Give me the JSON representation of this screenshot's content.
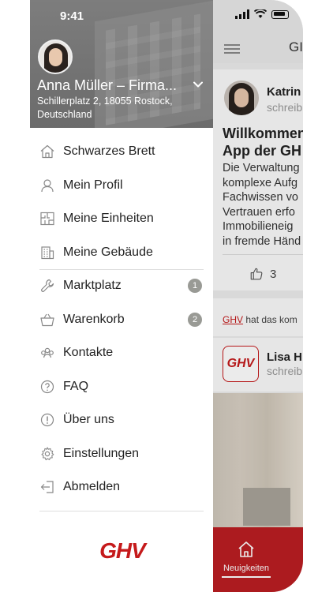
{
  "status_bar": {
    "time": "9:41"
  },
  "drawer": {
    "user_name": "Anna Müller – Firma...",
    "address": "Schillerplatz 2, 18055 Rostock, Deutschland",
    "menu_items": [
      {
        "label": "Schwarzes Brett",
        "icon": "house-icon"
      },
      {
        "label": "Mein Profil",
        "icon": "person-icon"
      },
      {
        "label": "Meine Einheiten",
        "icon": "floorplan-icon"
      },
      {
        "label": "Meine Gebäude",
        "icon": "building-icon"
      },
      {
        "label": "Marktplatz",
        "icon": "wrench-icon",
        "badge": "1"
      },
      {
        "label": "Warenkorb",
        "icon": "basket-icon",
        "badge": "2"
      },
      {
        "label": "Kontakte",
        "icon": "contacts-icon"
      },
      {
        "label": "FAQ",
        "icon": "question-icon"
      },
      {
        "label": "Über uns",
        "icon": "info-icon"
      },
      {
        "label": "Einstellungen",
        "icon": "gear-icon"
      },
      {
        "label": "Abmelden",
        "icon": "logout-icon"
      }
    ],
    "logo_text": "GHV"
  },
  "background": {
    "header_title": "GI",
    "post": {
      "author": "Katrin",
      "author_sub": "schreib",
      "title_lines": [
        "Willkommen",
        "App der GH"
      ],
      "body_lines": [
        "Die Verwaltung",
        "komplexe Aufg",
        "Fachwissen vo",
        "Vertrauen erfo",
        "Immobilieneig",
        "in fremde Händ"
      ],
      "likes": "3"
    },
    "notice": {
      "link": "GHV",
      "text": " hat das kom"
    },
    "post2": {
      "badge": "GHV",
      "author": "Lisa H",
      "author_sub": "schreib"
    },
    "tab": {
      "label": "Neuigkeiten"
    }
  },
  "colors": {
    "brand_red": "#c51a1b",
    "tab_red": "#bb1e22"
  }
}
